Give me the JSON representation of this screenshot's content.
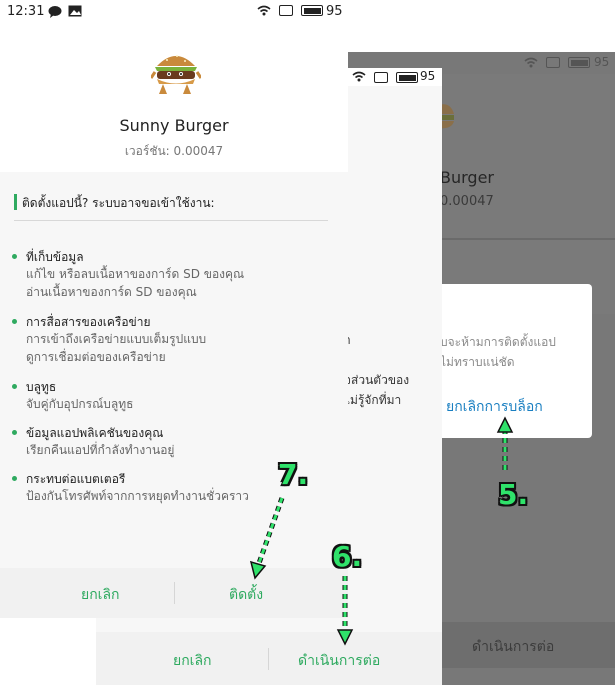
{
  "status_bar": {
    "time": "12:31",
    "battery": "95"
  },
  "app": {
    "name": "Sunny Burger",
    "version": "เวอร์ชัน: 0.00047"
  },
  "permissions": {
    "title": "ติดตั้งแอปนี้? ระบบอาจขอเข้าใช้งาน:",
    "items": [
      {
        "label": "ที่เก็บข้อมูล",
        "desc": [
          "แก้ไข หรือลบเนื้อหาของการ์ด SD ของคุณ",
          "อ่านเนื้อหาของการ์ด SD ของคุณ"
        ]
      },
      {
        "label": "การสื่อสารของเครือข่าย",
        "desc": [
          "การเข้าถึงเครือข่ายแบบเต็มรูปแบบ",
          "ดูการเชื่อมต่อของเครือข่าย"
        ]
      },
      {
        "label": "บลูทูธ",
        "desc": [
          "จับคู่กับอุปกรณ์บลูทูธ"
        ]
      },
      {
        "label": "ข้อมูลแอปพลิเคชันของคุณ",
        "desc": [
          "เรียกคืนแอปที่กำลังทำงานอยู่"
        ]
      },
      {
        "label": "กระทบต่อแบตเตอรี",
        "desc": [
          "ป้องกันโทรศัพท์จากการหยุดทำงานชั่วคราว"
        ]
      }
    ]
  },
  "left_buttons": {
    "cancel": "ยกเลิก",
    "install": "ติดตั้ง"
  },
  "middle": {
    "partial_text": "า\n\nจส่วนตัวของ\nไม่รู้จักที่มา",
    "cancel": "ยกเลิก",
    "continue": "ดำเนินการต่อ"
  },
  "right": {
    "app_name": "Burger",
    "version": "0.00047",
    "dialog_text": "บจะห้ามการติดตั้งแอป\nไม่ทราบแน่ชัด",
    "unblock": "ยกเลิกการบล็อก",
    "continue": "ดำเนินการต่อ"
  },
  "annotations": {
    "step5": "5.",
    "step6": "6.",
    "step7": "7."
  },
  "colors": {
    "accent_green": "#2faa60",
    "link_blue": "#1a7fc1",
    "step_green": "#2fe26a"
  }
}
